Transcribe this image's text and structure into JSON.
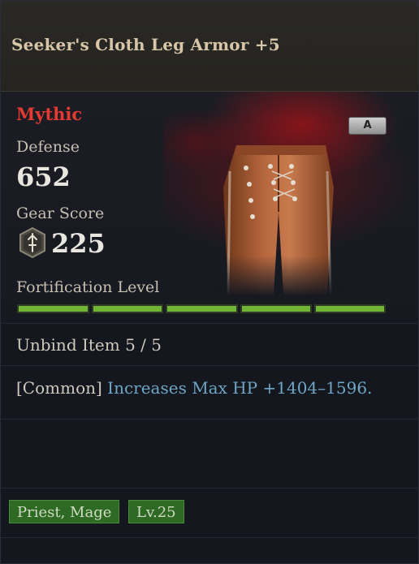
{
  "item": {
    "name": "Seeker's Cloth Leg Armor +5",
    "rarity": "Mythic",
    "grade": "A",
    "stats": {
      "defense_label": "Defense",
      "defense_value": "652",
      "gear_score_label": "Gear Score",
      "gear_score_value": "225"
    },
    "fortification": {
      "label": "Fortification Level",
      "filled": 5,
      "total": 5
    },
    "unbind": "Unbind Item 5 / 5",
    "effect": {
      "prefix": "[Common]",
      "text": "Increases Max HP +1404–1596."
    },
    "tags": [
      "Priest, Mage",
      "Lv.25"
    ]
  },
  "colors": {
    "rarity": "#e43a32",
    "fortification_bar": "#71b534",
    "effect_text": "#6fa6c6",
    "tag_bg": "#2f6a25"
  },
  "icons": [
    "gear-score-icon",
    "grade-badge",
    "leg-armor-image"
  ]
}
